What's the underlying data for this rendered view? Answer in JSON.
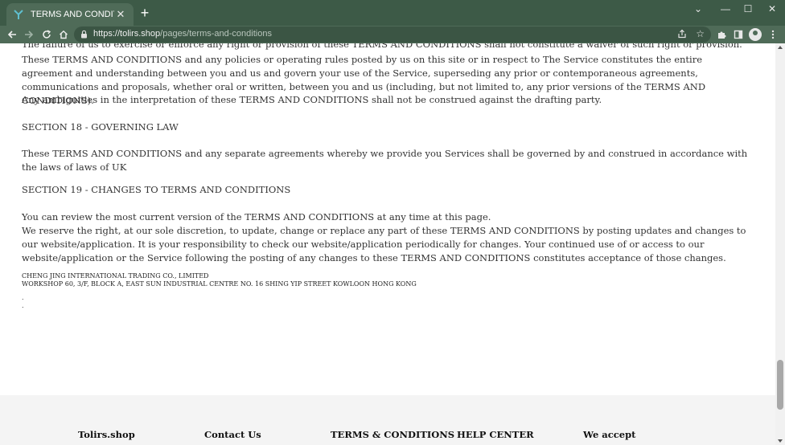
{
  "browser": {
    "tab_title": "TERMS AND CONDITIONS",
    "tab_close": "✕",
    "new_tab": "+",
    "url_host": "https://tolirs.shop",
    "url_path": "/pages/terms-and-conditions",
    "window_controls": {
      "menu": "⌄",
      "minimize": "—",
      "maximize": "☐",
      "close": "✕"
    }
  },
  "content": {
    "cut_line": "The failure of us to exercise or enforce any right or provision of these TERMS AND CONDITIONS shall not constitute a waiver of such right or provision.",
    "para_entire": "These TERMS AND CONDITIONS and any policies or operating rules posted by us on this site or in respect to The Service constitutes the entire agreement and understanding between you and us and govern your use of the Service, superseding any prior or contemporaneous agreements, communications and proposals, whether oral or written, between you and us (including, but not limited to, any prior versions of the TERMS AND CONDITIONS).",
    "para_ambiguities": "Any ambiguities in the interpretation of these TERMS AND CONDITIONS shall not be construed against the drafting party.",
    "section18_heading": "SECTION 18 - GOVERNING LAW",
    "section18_text": "These TERMS AND CONDITIONS and any separate agreements whereby we provide you Services shall be governed by and construed in accordance with the laws of laws of UK",
    "section19_heading": "SECTION 19 - CHANGES TO TERMS AND CONDITIONS",
    "section19_p1": "You can review the most current version of the TERMS AND CONDITIONS at any time at this page.",
    "section19_p2": "We reserve the right, at our sole discretion, to update, change or replace any part of these TERMS AND CONDITIONS by posting updates and changes to our website/application. It is your responsibility to check our website/application periodically for changes. Your continued use of or access to our website/application or the Service following the posting of any changes to these TERMS AND CONDITIONS constitutes acceptance of those changes.",
    "company_name": "CHENG JING INTERNATIONAL TRADING CO., LIMITED",
    "company_address": "WORKSHOP 60, 3/F, BLOCK A, EAST SUN INDUSTRIAL CENTRE NO. 16 SHING YIP STREET KOWLOON HONG KONG",
    "dot1": ".",
    "dot2": "."
  },
  "footer": {
    "columns": [
      "Tolirs.shop",
      "Contact Us",
      "TERMS & CONDITIONS",
      "HELP CENTER",
      "We accept"
    ]
  },
  "colors": {
    "chrome_dark": "#3d5a47",
    "chrome_tab": "#4f6b58",
    "footer_bg": "#f4f4f4"
  }
}
